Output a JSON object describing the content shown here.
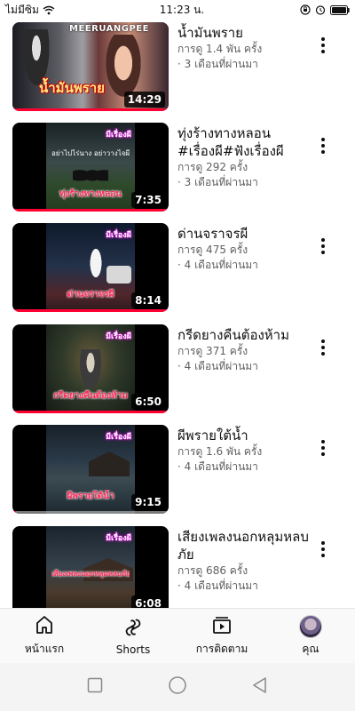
{
  "status_bar": {
    "carrier": "ไม่มีซิม",
    "time": "11:23 น."
  },
  "videos": [
    {
      "title": "น้ำมันพราย",
      "views": "การดู 1.4 พัน ครั้ง",
      "age": "· 3 เดือนที่ผ่านมา",
      "duration": "14:29",
      "thumb_tag": "MEERUANGPEE",
      "thumb_caption": "น้ำมันพราย",
      "progress": 1.0
    },
    {
      "title": "ทุ่งร้างทางหลอน #เรื่องผี#ฟังเรื่องผี",
      "views": "การดู 292 ครั้ง",
      "age": "· 3 เดือนที่ผ่านมา",
      "duration": "7:35",
      "thumb_tag": "มีเรื่องผี",
      "thumb_sub": "อย่าไปไร่นาง อย่าวางไจผี",
      "thumb_caption": "ทุ่งร้างทางหลอน",
      "progress": 1.0
    },
    {
      "title": "ด่านจราจรผี",
      "views": "การดู 475 ครั้ง",
      "age": "· 4 เดือนที่ผ่านมา",
      "duration": "8:14",
      "thumb_tag": "มีเรื่องผี",
      "thumb_caption": "ด่านจราจรผี",
      "progress": 1.0
    },
    {
      "title": "กรีดยางคืนต้องห้าม",
      "views": "การดู 371 ครั้ง",
      "age": "· 4 เดือนที่ผ่านมา",
      "duration": "6:50",
      "thumb_tag": "มีเรื่องผี",
      "thumb_caption": "กรีดยางคืนต้องห้าม",
      "progress": 1.0
    },
    {
      "title": "ผีพรายใต้น้ำ",
      "views": "การดู 1.6 พัน ครั้ง",
      "age": "· 4 เดือนที่ผ่านมา",
      "duration": "9:15",
      "thumb_tag": "มีเรื่องผี",
      "thumb_caption": "ผีพรายใต้น้ำ",
      "progress": 0.02
    },
    {
      "title": "เสียงเพลงนอกหลุมหลบภัย",
      "views": "การดู 686 ครั้ง",
      "age": "· 4 เดือนที่ผ่านมา",
      "duration": "6:08",
      "thumb_tag": "มีเรื่องผี",
      "thumb_caption": "เสียงเพลงนอกหลุมหลบภัย",
      "progress": 0
    }
  ],
  "bottom_nav": {
    "home_label": "หน้าแรก",
    "shorts_label": "Shorts",
    "subscriptions_label": "การติดตาม",
    "you_label": "คุณ"
  },
  "colors": {
    "progress": "#ff0033",
    "text_primary": "#0f0f0f",
    "text_secondary": "#606060"
  }
}
